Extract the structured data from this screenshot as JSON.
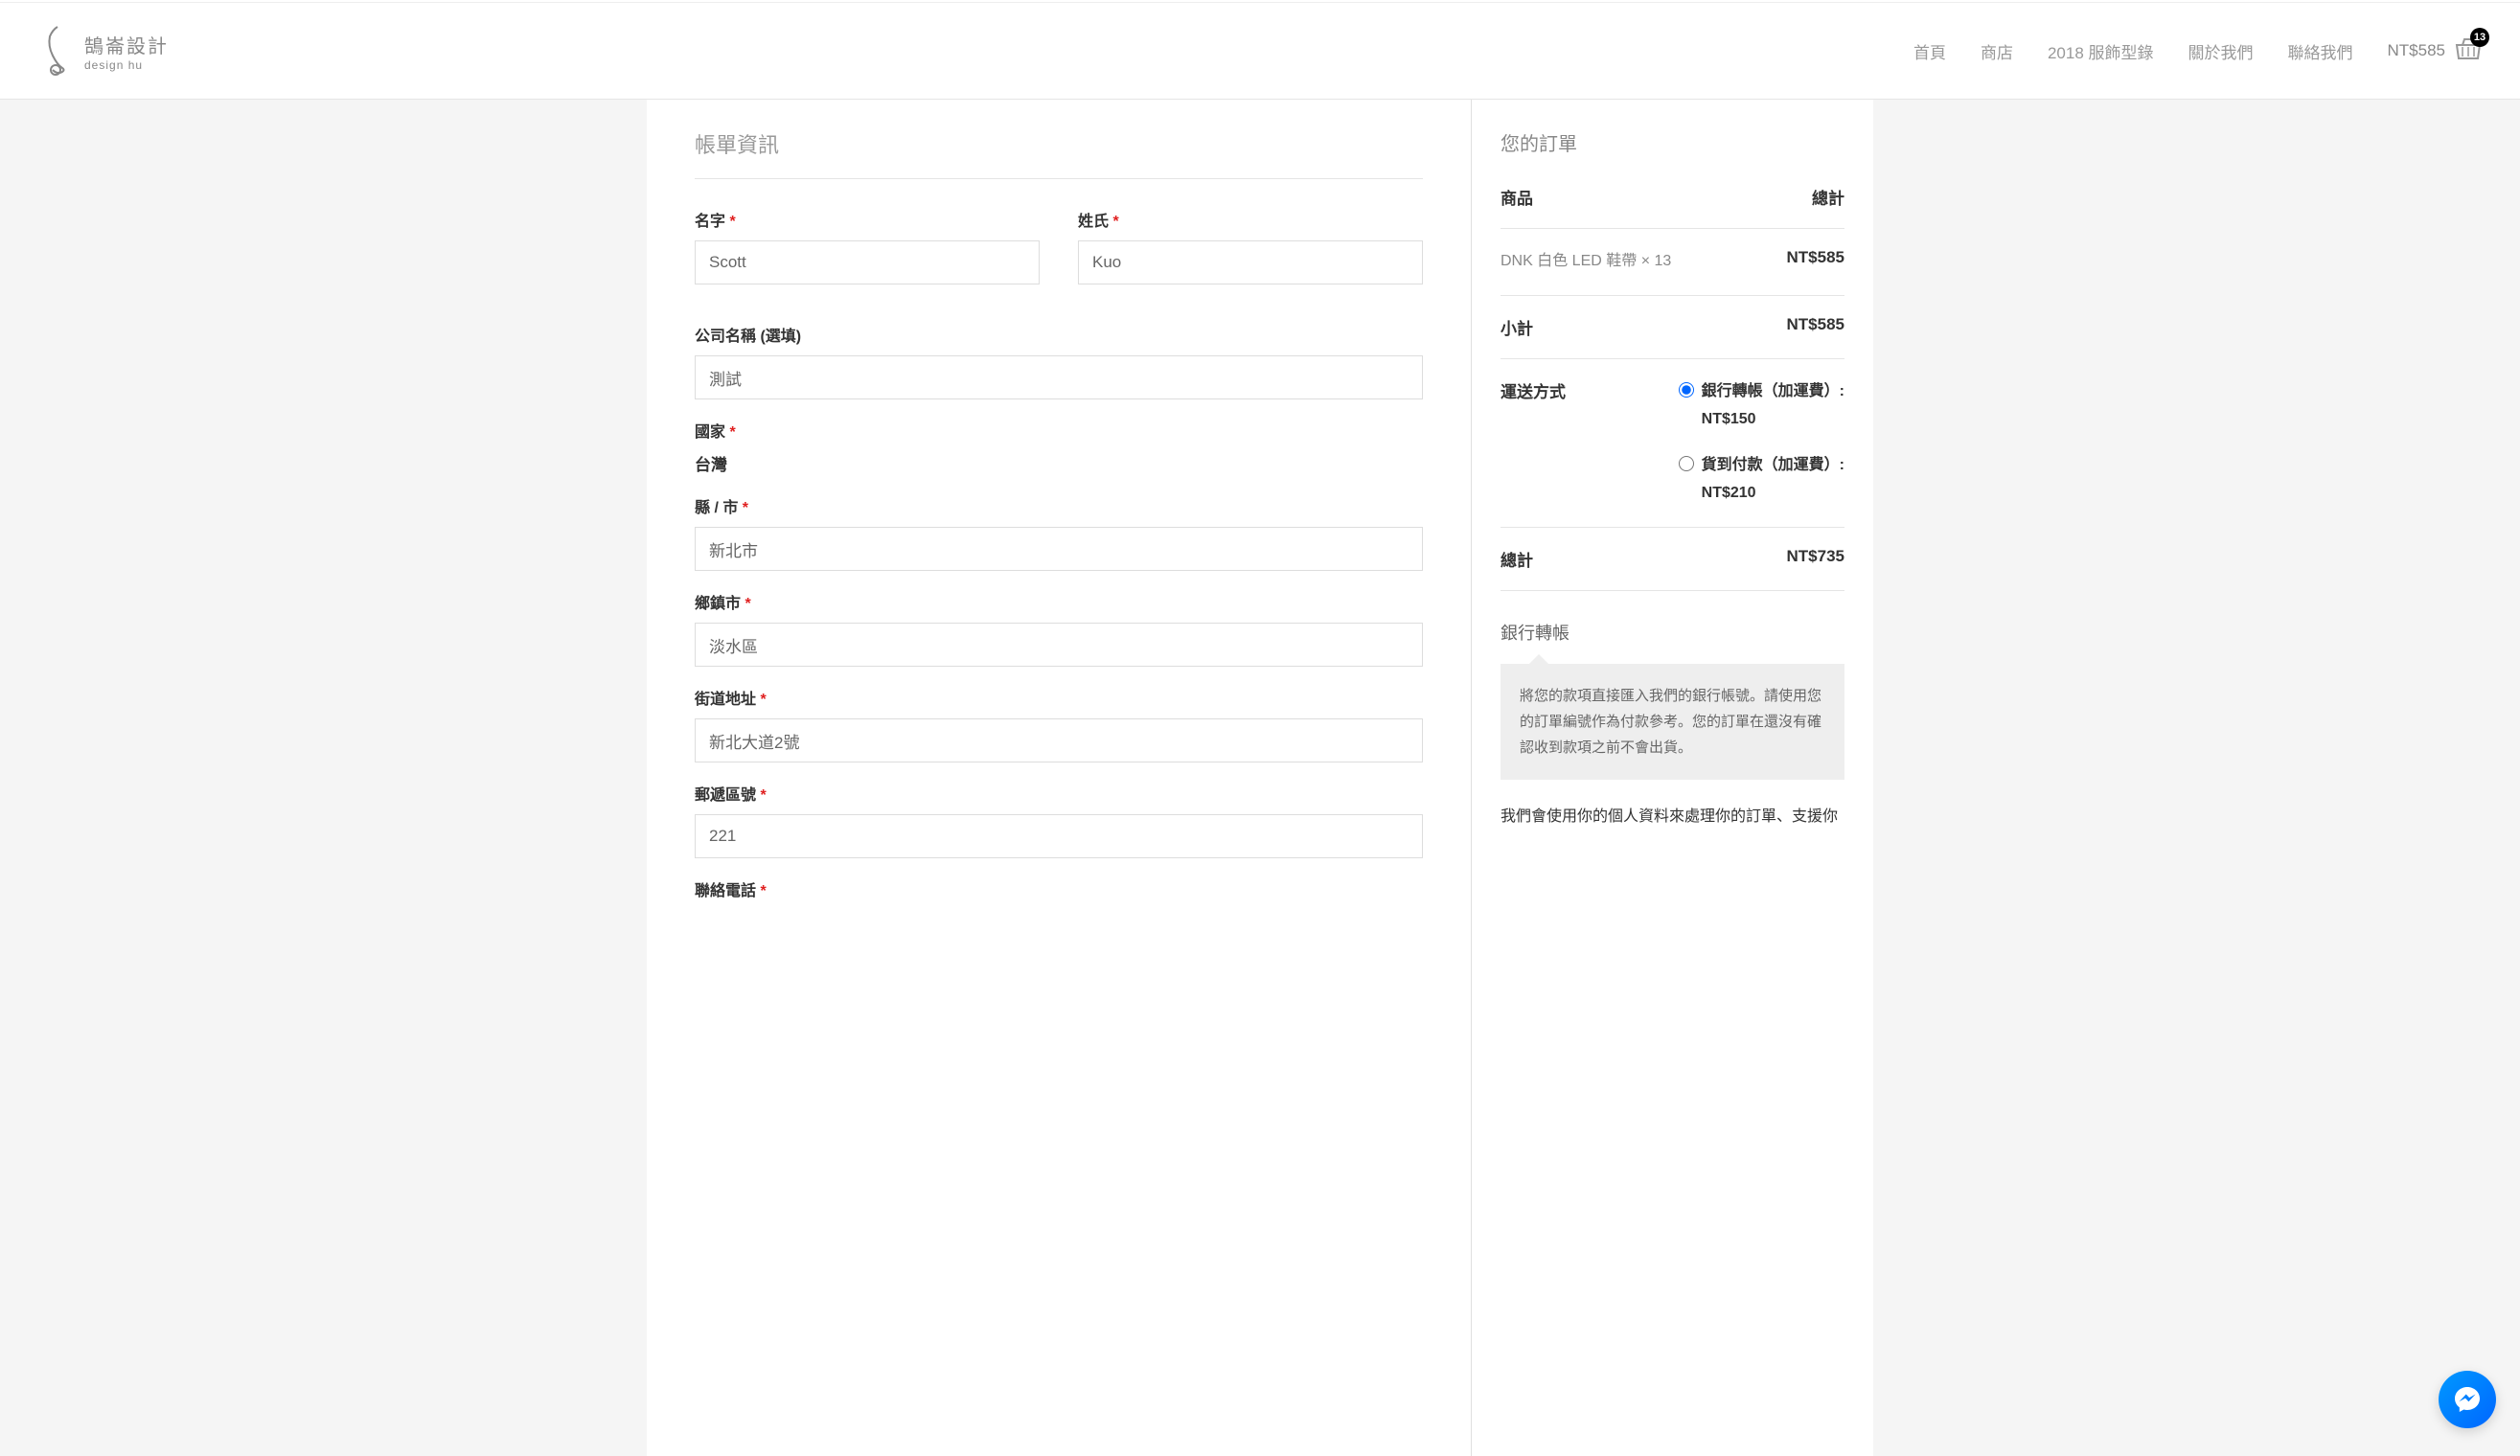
{
  "header": {
    "logo_main": "鵠崙設計",
    "logo_sub": "design hu",
    "nav": [
      "首頁",
      "商店",
      "2018 服飾型錄",
      "關於我們",
      "聯絡我們"
    ],
    "cart_total": "NT$585",
    "cart_count": "13"
  },
  "billing": {
    "title": "帳單資訊",
    "labels": {
      "first_name": "名字",
      "last_name": "姓氏",
      "company": "公司名稱 (選填)",
      "country": "國家",
      "country_value": "台灣",
      "state": "縣 / 市",
      "city": "鄉鎮市",
      "address": "街道地址",
      "postcode": "郵遞區號",
      "phone": "聯絡電話"
    },
    "values": {
      "first_name": "Scott",
      "last_name": "Kuo",
      "company": "測試",
      "state": "新北市",
      "city": "淡水區",
      "address": "新北大道2號",
      "postcode": "221"
    }
  },
  "order": {
    "title": "您的訂單",
    "header_product": "商品",
    "header_total": "總計",
    "product_name": "DNK 白色 LED 鞋帶 × 13",
    "product_price": "NT$585",
    "subtotal_label": "小計",
    "subtotal_value": "NT$585",
    "shipping_label": "運送方式",
    "shipping_options": [
      {
        "label": "銀行轉帳（加運費）:",
        "price": "NT$150",
        "selected": true
      },
      {
        "label": "貨到付款（加運費）:",
        "price": "NT$210",
        "selected": false
      }
    ],
    "total_label": "總計",
    "total_value": "NT$735",
    "payment_method": "銀行轉帳",
    "payment_info": "將您的款項直接匯入我們的銀行帳號。請使用您的訂單編號作為付款參考。您的訂單在還沒有確認收到款項之前不會出貨。",
    "privacy_text": "我們會使用你的個人資料來處理你的訂單、支援你"
  }
}
